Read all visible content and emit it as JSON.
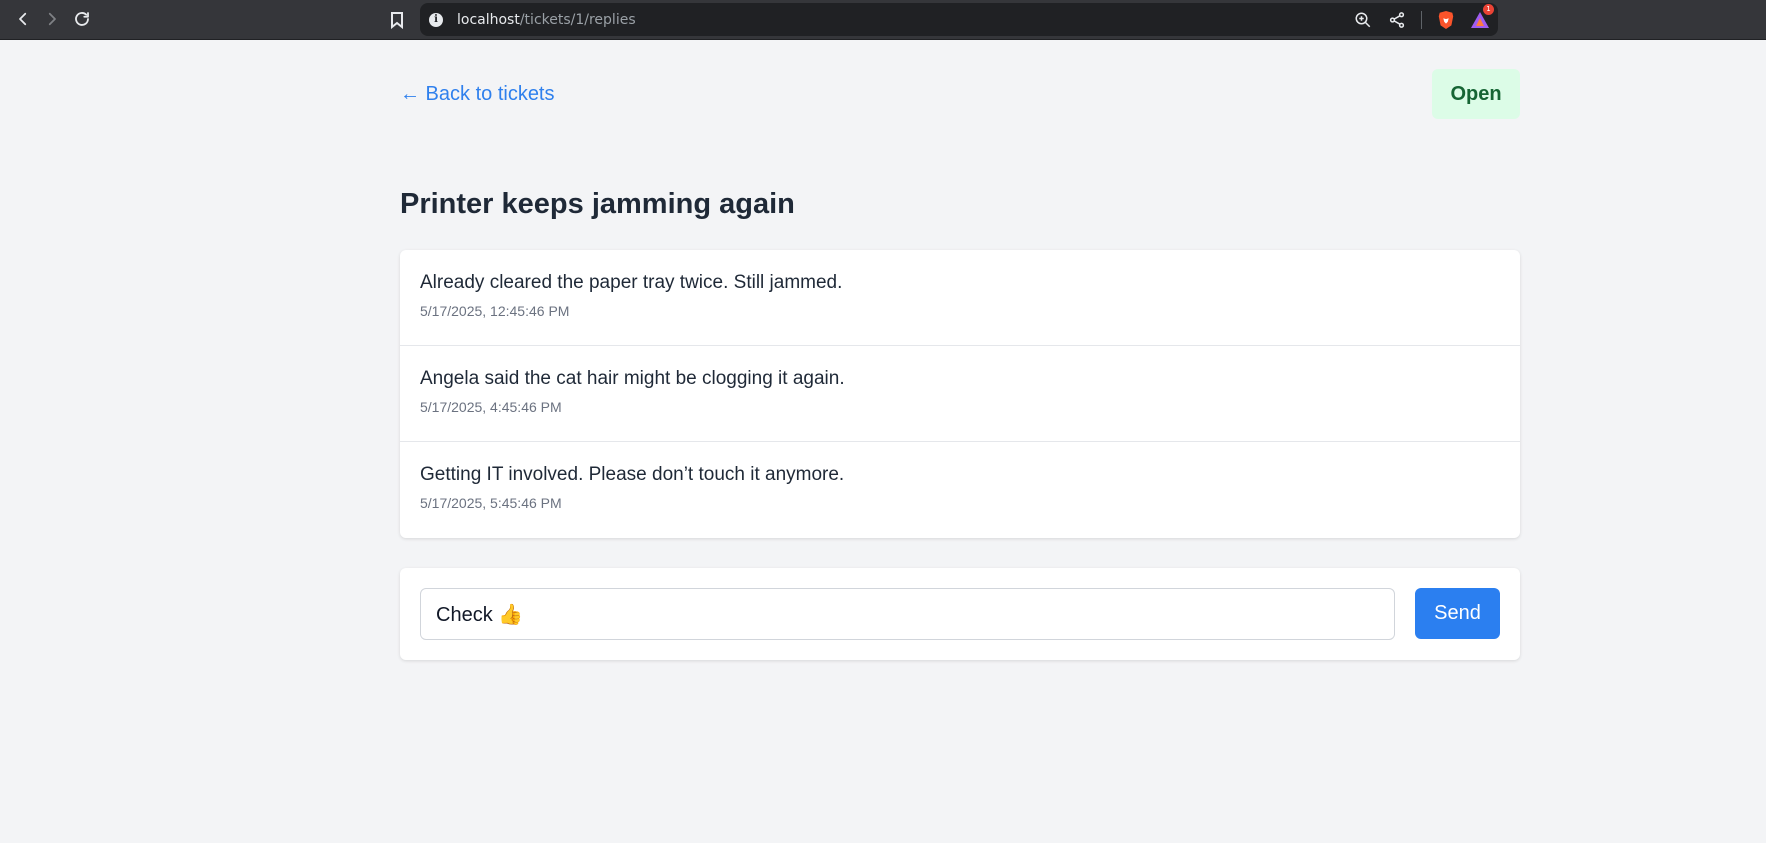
{
  "browser": {
    "url_host": "localhost",
    "url_path": "/tickets/1/replies",
    "rewards_badge": "1"
  },
  "ticket": {
    "back_label": "← Back to tickets",
    "status": "Open",
    "title": "Printer keeps jamming again"
  },
  "replies": [
    {
      "text": "Already cleared the paper tray twice. Still jammed.",
      "timestamp": "5/17/2025, 12:45:46 PM"
    },
    {
      "text": "Angela said the cat hair might be clogging it again.",
      "timestamp": "5/17/2025, 4:45:46 PM"
    },
    {
      "text": "Getting IT involved. Please don’t touch it anymore.",
      "timestamp": "5/17/2025, 5:45:46 PM"
    }
  ],
  "composer": {
    "value": "Check 👍",
    "send_label": "Send"
  },
  "colors": {
    "accent": "#2b7ff0",
    "status_bg": "#dcfce7",
    "status_text": "#166534"
  }
}
